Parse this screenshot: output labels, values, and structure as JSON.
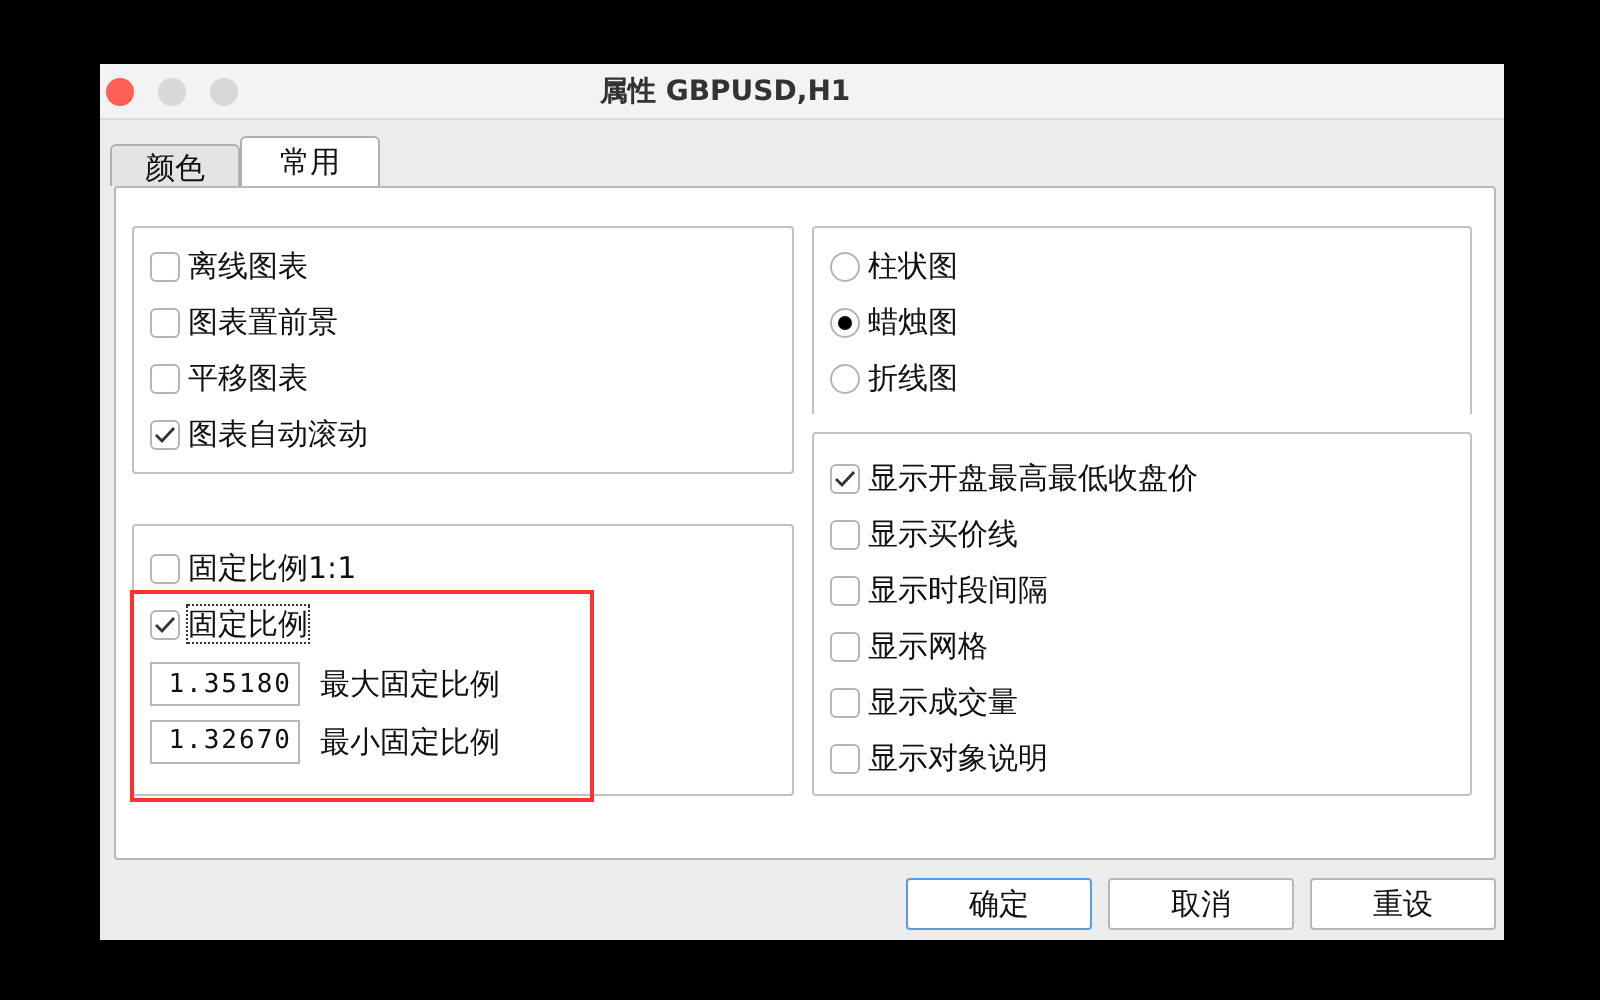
{
  "window": {
    "title": "属性 GBPUSD,H1"
  },
  "tabs": [
    {
      "label": "颜色",
      "selected": false
    },
    {
      "label": "常用",
      "selected": true
    }
  ],
  "chart_options": [
    {
      "label": "离线图表",
      "checked": false
    },
    {
      "label": "图表置前景",
      "checked": false
    },
    {
      "label": "平移图表",
      "checked": false
    },
    {
      "label": "图表自动滚动",
      "checked": true
    }
  ],
  "scale_options": [
    {
      "label": "固定比例1:1",
      "checked": false,
      "focused": false
    },
    {
      "label": "固定比例",
      "checked": true,
      "focused": true
    }
  ],
  "scale_fields": [
    {
      "value": "1.35180",
      "label": "最大固定比例"
    },
    {
      "value": "1.32670",
      "label": "最小固定比例"
    }
  ],
  "chart_types": [
    {
      "label": "柱状图",
      "selected": false
    },
    {
      "label": "蜡烛图",
      "selected": true
    },
    {
      "label": "折线图",
      "selected": false
    }
  ],
  "display_options": [
    {
      "label": "显示开盘最高最低收盘价",
      "checked": true
    },
    {
      "label": "显示买价线",
      "checked": false
    },
    {
      "label": "显示时段间隔",
      "checked": false
    },
    {
      "label": "显示网格",
      "checked": false
    },
    {
      "label": "显示成交量",
      "checked": false
    },
    {
      "label": "显示对象说明",
      "checked": false
    }
  ],
  "buttons": [
    {
      "label": "确定",
      "default": true
    },
    {
      "label": "取消",
      "default": false
    },
    {
      "label": "重设",
      "default": false
    }
  ]
}
